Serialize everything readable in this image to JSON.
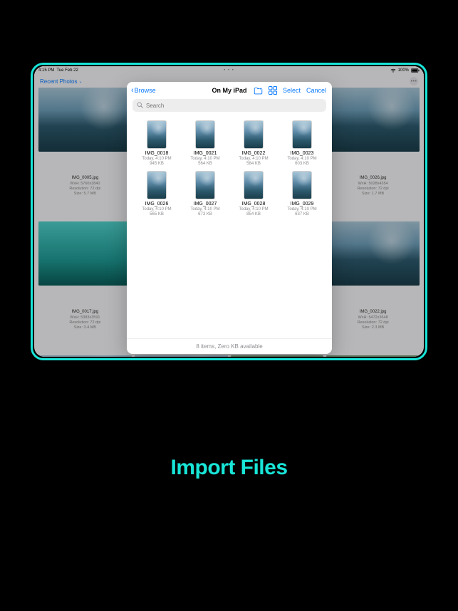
{
  "caption": "Import Files",
  "status": {
    "time": "4:15 PM",
    "date": "Tue Feb 22",
    "handle": "• • •",
    "battery": "100%"
  },
  "app": {
    "menu_label": "Recent Photos",
    "more_glyph": "•••"
  },
  "gallery": {
    "items": [
      {
        "name": "IMG_0005.jpg",
        "wh": "WxH: 5760x3840",
        "res": "Resolution: 72 dpi",
        "size": "Size: 5.7 MB"
      },
      {
        "name": "IMG_0017.jpg",
        "wh": "WxH: 5383x3591",
        "res": "Resolution: 72 dpi",
        "size": "Size: 3.4 MB"
      },
      {
        "name": "IMG_0026.jpg",
        "wh": "WxH: 5028x4354",
        "res": "Resolution: 72 dpi",
        "size": "Size: 1.7 MB"
      },
      {
        "name": "IMG_0022.jpg",
        "wh": "WxH: 5472x3648",
        "res": "Resolution: 72 dpi",
        "size": "Size: 2.3 MB"
      }
    ]
  },
  "picker": {
    "back_label": "Browse",
    "title": "On My iPad",
    "select_label": "Select",
    "cancel_label": "Cancel",
    "search_placeholder": "Search",
    "footer": "8 items, Zero KB available",
    "files": [
      {
        "name": "IMG_0018",
        "time": "Today, 4:10 PM",
        "size": "945 KB"
      },
      {
        "name": "IMG_0021",
        "time": "Today, 4:10 PM",
        "size": "564 KB"
      },
      {
        "name": "IMG_0022",
        "time": "Today, 4:10 PM",
        "size": "584 KB"
      },
      {
        "name": "IMG_0023",
        "time": "Today, 4:10 PM",
        "size": "603 KB"
      },
      {
        "name": "IMG_0026",
        "time": "Today, 4:10 PM",
        "size": "565 KB"
      },
      {
        "name": "IMG_0027",
        "time": "Today, 4:10 PM",
        "size": "673 KB"
      },
      {
        "name": "IMG_0028",
        "time": "Today, 4:10 PM",
        "size": "854 KB"
      },
      {
        "name": "IMG_0029",
        "time": "Today, 4:10 PM",
        "size": "637 KB"
      }
    ]
  }
}
